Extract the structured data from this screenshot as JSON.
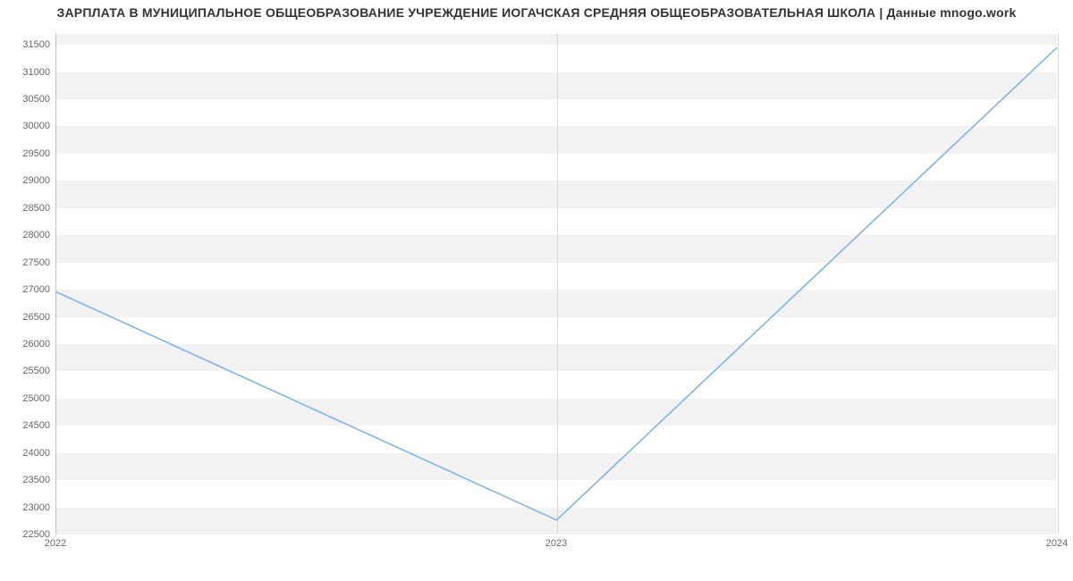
{
  "chart_data": {
    "type": "line",
    "title": "ЗАРПЛАТА В МУНИЦИПАЛЬНОЕ ОБЩЕОБРАЗОВАНИЕ УЧРЕЖДЕНИЕ ИОГАЧСКАЯ СРЕДНЯЯ ОБЩЕОБРАЗОВАТЕЛЬНАЯ ШКОЛА | Данные mnogo.work",
    "xlabel": "",
    "ylabel": "",
    "x": [
      "2022",
      "2023",
      "2024"
    ],
    "values": [
      26950,
      22750,
      31450
    ],
    "y_ticks": [
      22500,
      23000,
      23500,
      24000,
      24500,
      25000,
      25500,
      26000,
      26500,
      27000,
      27500,
      28000,
      28500,
      29000,
      29500,
      30000,
      30500,
      31000,
      31500
    ],
    "ylim": [
      22500,
      31700
    ],
    "line_color": "#7cb5ec",
    "band_color": "#f2f2f2"
  }
}
